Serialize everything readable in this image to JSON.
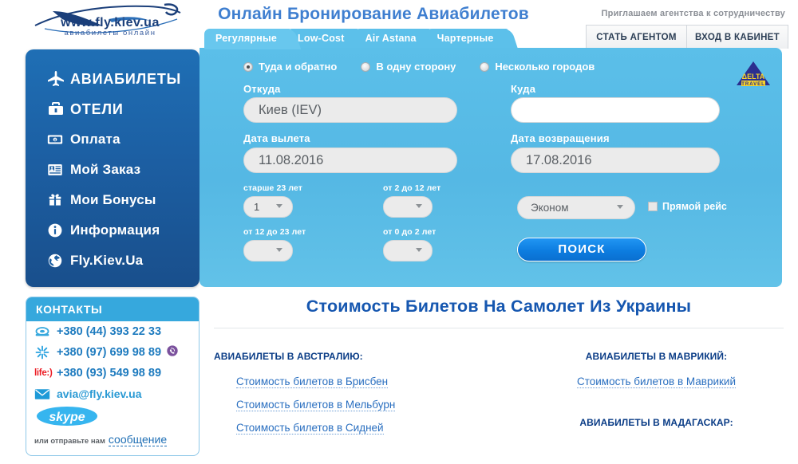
{
  "header": {
    "logo_url": "www.fly.kiev.ua",
    "logo_sub": "авиабилеты  онлайн",
    "site_title": "Онлайн Бронирование Авиабилетов",
    "invite_text": "Приглашаем агентства к сотрудничеству",
    "buttons": [
      {
        "label": "СТАТЬ АГЕНТОМ",
        "name": "become-agent-button"
      },
      {
        "label": "ВХОД В КАБИНЕТ",
        "name": "login-cabinet-button"
      }
    ]
  },
  "tabs": [
    {
      "label": "Регулярные",
      "active": true
    },
    {
      "label": "Low-Cost",
      "active": false
    },
    {
      "label": "Air Astana",
      "active": false
    },
    {
      "label": "Чартерные",
      "active": false
    }
  ],
  "sidebar": {
    "items": [
      {
        "label": "АВИАБИЛЕТЫ",
        "icon": "plane-icon"
      },
      {
        "label": "ОТЕЛИ",
        "icon": "briefcase-icon"
      },
      {
        "label": "Оплата",
        "icon": "banknote-icon"
      },
      {
        "label": "Мой Заказ",
        "icon": "id-card-icon"
      },
      {
        "label": "Мои Бонусы",
        "icon": "gift-icon"
      },
      {
        "label": "Информация",
        "icon": "info-icon"
      },
      {
        "label": "Fly.Kiev.Ua",
        "icon": "globe-icon"
      }
    ]
  },
  "search_form": {
    "trip_types": [
      {
        "label": "Туда и обратно",
        "selected": true
      },
      {
        "label": "В одну сторону",
        "selected": false
      },
      {
        "label": "Несколько городов",
        "selected": false
      }
    ],
    "origin_label": "Откуда",
    "origin_value": "Киев (IEV)",
    "destination_label": "Куда",
    "destination_value": "",
    "destination_placeholder": "",
    "depart_label": "Дата вылета",
    "depart_value": "11.08.2016",
    "return_label": "Дата возвращения",
    "return_value": "17.08.2016",
    "pax": [
      {
        "label": "старше 23 лет",
        "value": "1"
      },
      {
        "label": "от 2 до 12 лет",
        "value": ""
      },
      {
        "label": "от 12 до 23 лет",
        "value": ""
      },
      {
        "label": "от 0 до 2 лет",
        "value": ""
      }
    ],
    "class_value": "Эконом",
    "direct_label": "Прямой рейс",
    "direct_checked": false,
    "search_button": "ПОИСК",
    "partner_logo_main": "ΔELTA",
    "partner_logo_sub": "TRAVEL"
  },
  "contacts": {
    "title": "КОНТАКТЫ",
    "rows": [
      {
        "icon": "phone-icon",
        "text": "+380 (44) 393 22 33",
        "badge": ""
      },
      {
        "icon": "kyivstar-icon",
        "text": "+380 (97) 699 98 89",
        "badge": "viber-icon"
      },
      {
        "icon": "life-icon",
        "text": "+380 (93) 549 98 89",
        "badge": ""
      },
      {
        "icon": "envelope-icon",
        "text": "avia@fly.kiev.ua",
        "badge": ""
      }
    ],
    "skype_label": "skype",
    "message_prefix": "или отправьте нам",
    "message_link": "сообщение"
  },
  "content": {
    "heading": "Стоимость Билетов На Самолет Из Украины",
    "left_column": {
      "category": "АВИАБИЛЕТЫ В АВСТРАЛИЮ:",
      "links": [
        "Стоимость билетов в Брисбен",
        "Стоимость билетов в Мельбурн",
        "Стоимость билетов в Сидней"
      ]
    },
    "right_column": {
      "category_1": "АВИАБИЛЕТЫ В МАВРИКИЙ:",
      "links_1": [
        "Стоимость билетов в Маврикий"
      ],
      "category_2": "АВИАБИЛЕТЫ В МАДАГАСКАР:"
    }
  },
  "colors": {
    "panel_blue": "#5bbfe9",
    "sidebar_blue": "#1c5fa3",
    "accent_blue": "#0d7de0",
    "title_blue": "#3f7fd0",
    "heading_blue": "#1657b0"
  }
}
